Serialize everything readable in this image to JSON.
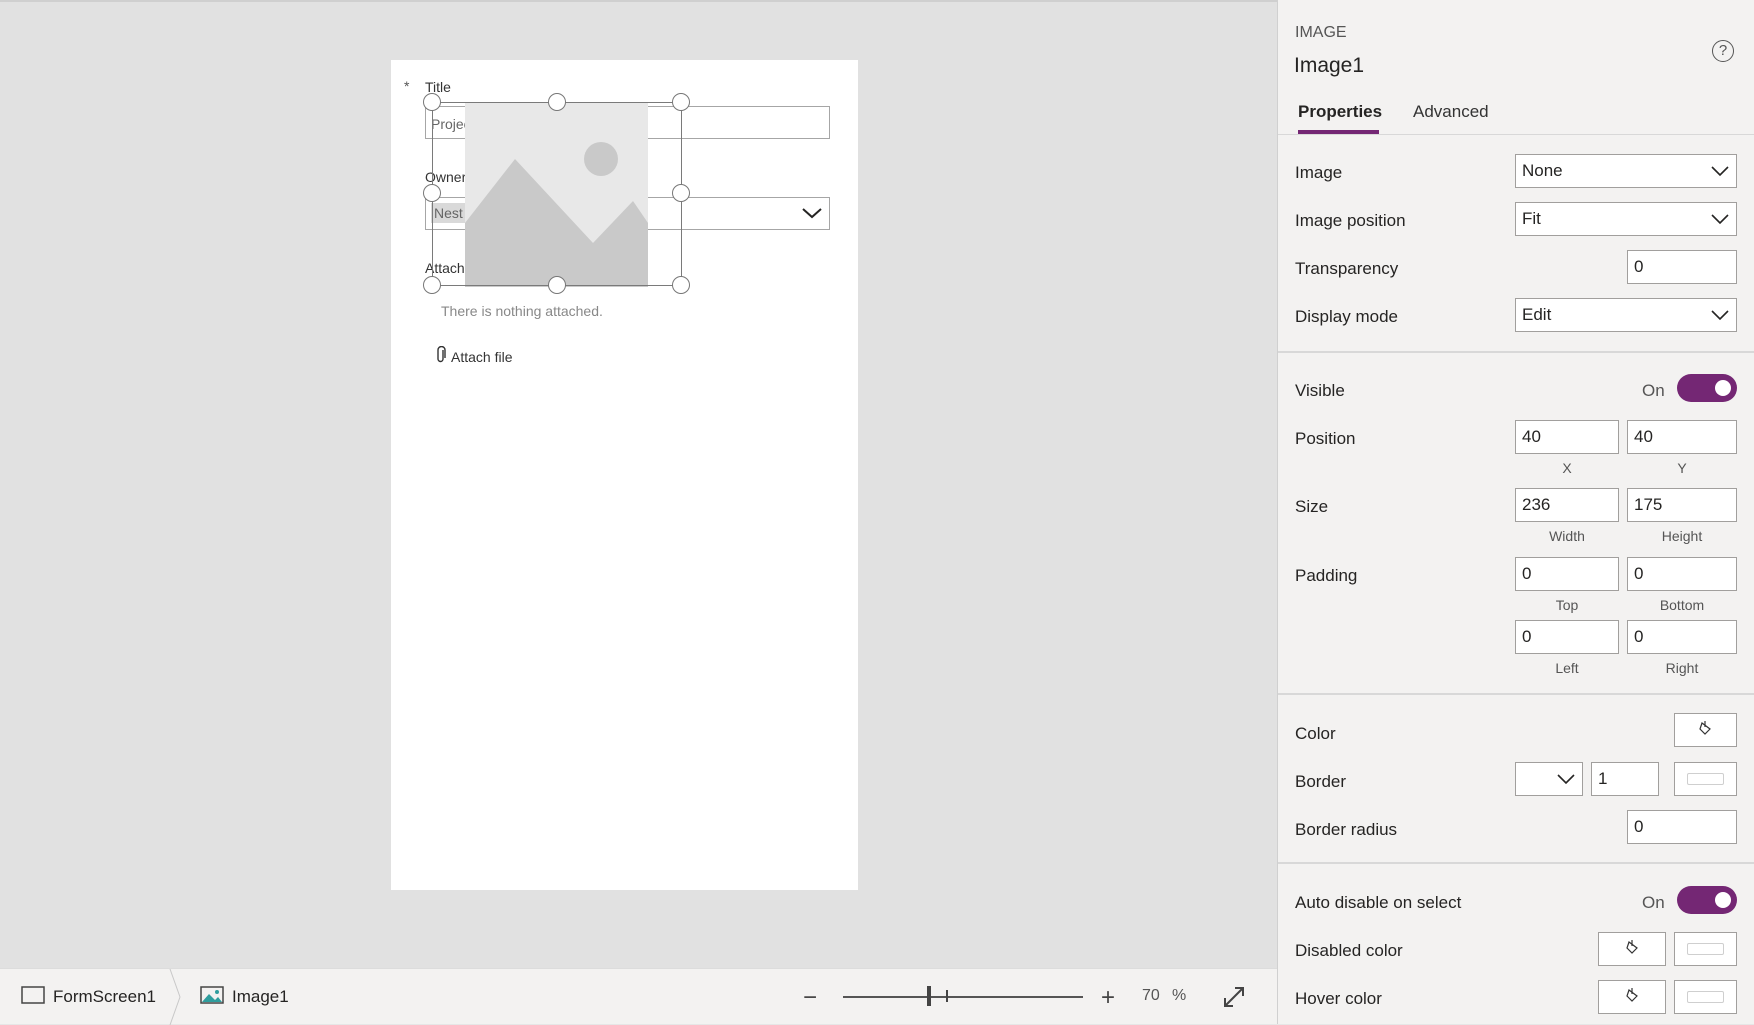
{
  "canvas": {
    "form": {
      "title_label": "Title",
      "title_value": "Projec",
      "owner_label": "Owner",
      "owner_value": "Nest",
      "attachments_label": "Attach",
      "attachments_empty": "There is nothing attached.",
      "attach_button": "Attach file"
    }
  },
  "bottom_bar": {
    "screen_crumb": "FormScreen1",
    "control_crumb": "Image1",
    "zoom_minus": "−",
    "zoom_plus": "+",
    "zoom_value": "70",
    "zoom_unit": "%"
  },
  "panel": {
    "control_type": "IMAGE",
    "control_name": "Image1",
    "help": "?",
    "tabs": {
      "properties": "Properties",
      "advanced": "Advanced"
    },
    "props": {
      "image": {
        "label": "Image",
        "value": "None"
      },
      "image_position": {
        "label": "Image position",
        "value": "Fit"
      },
      "transparency": {
        "label": "Transparency",
        "value": "0"
      },
      "display_mode": {
        "label": "Display mode",
        "value": "Edit"
      },
      "visible": {
        "label": "Visible",
        "state": "On"
      },
      "position": {
        "label": "Position",
        "x": "40",
        "y": "40",
        "x_caption": "X",
        "y_caption": "Y"
      },
      "size": {
        "label": "Size",
        "width": "236",
        "height": "175",
        "width_caption": "Width",
        "height_caption": "Height"
      },
      "padding": {
        "label": "Padding",
        "top": "0",
        "bottom": "0",
        "left": "0",
        "right": "0",
        "top_caption": "Top",
        "bottom_caption": "Bottom",
        "left_caption": "Left",
        "right_caption": "Right"
      },
      "color": {
        "label": "Color"
      },
      "border": {
        "label": "Border",
        "width": "1"
      },
      "border_radius": {
        "label": "Border radius",
        "value": "0"
      },
      "auto_disable": {
        "label": "Auto disable on select",
        "state": "On"
      },
      "disabled_color": {
        "label": "Disabled color"
      },
      "hover_color": {
        "label": "Hover color"
      }
    }
  },
  "colors": {
    "accent": "#742774"
  }
}
